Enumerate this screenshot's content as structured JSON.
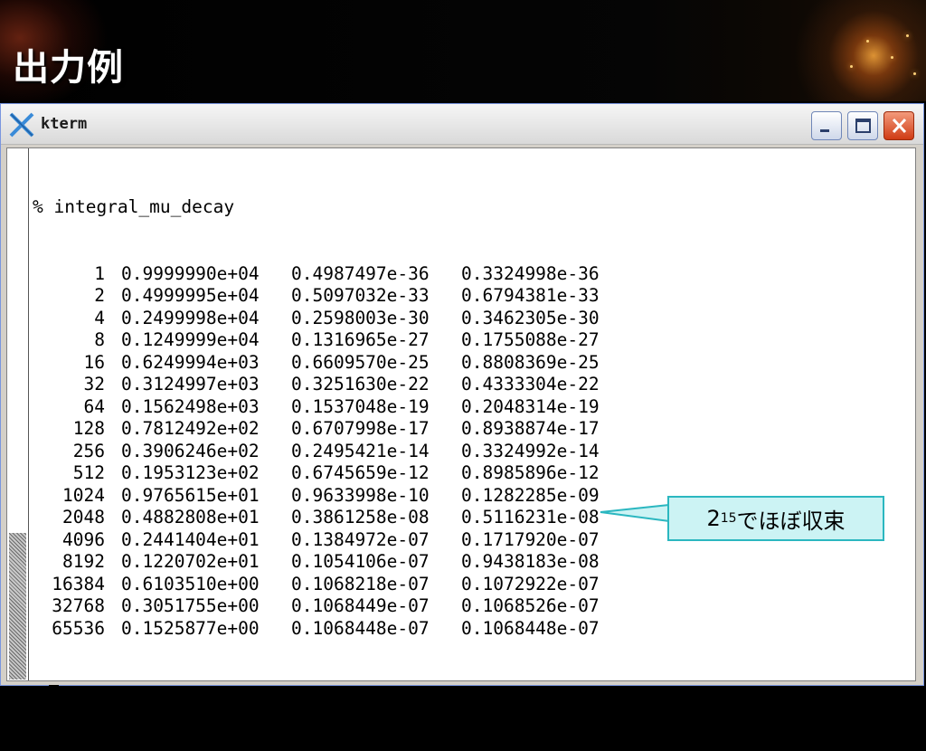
{
  "slide": {
    "title": "出力例"
  },
  "window": {
    "title": "kterm",
    "app_icon": "x-logo-icon",
    "controls": [
      "minimize-icon",
      "maximize-icon",
      "close-icon"
    ]
  },
  "terminal": {
    "command_line": "% integral_mu_decay",
    "rows": [
      [
        "1",
        "0.9999990e+04",
        "0.4987497e-36",
        "0.3324998e-36"
      ],
      [
        "2",
        "0.4999995e+04",
        "0.5097032e-33",
        "0.6794381e-33"
      ],
      [
        "4",
        "0.2499998e+04",
        "0.2598003e-30",
        "0.3462305e-30"
      ],
      [
        "8",
        "0.1249999e+04",
        "0.1316965e-27",
        "0.1755088e-27"
      ],
      [
        "16",
        "0.6249994e+03",
        "0.6609570e-25",
        "0.8808369e-25"
      ],
      [
        "32",
        "0.3124997e+03",
        "0.3251630e-22",
        "0.4333304e-22"
      ],
      [
        "64",
        "0.1562498e+03",
        "0.1537048e-19",
        "0.2048314e-19"
      ],
      [
        "128",
        "0.7812492e+02",
        "0.6707998e-17",
        "0.8938874e-17"
      ],
      [
        "256",
        "0.3906246e+02",
        "0.2495421e-14",
        "0.3324992e-14"
      ],
      [
        "512",
        "0.1953123e+02",
        "0.6745659e-12",
        "0.8985896e-12"
      ],
      [
        "1024",
        "0.9765615e+01",
        "0.9633998e-10",
        "0.1282285e-09"
      ],
      [
        "2048",
        "0.4882808e+01",
        "0.3861258e-08",
        "0.5116231e-08"
      ],
      [
        "4096",
        "0.2441404e+01",
        "0.1384972e-07",
        "0.1717920e-07"
      ],
      [
        "8192",
        "0.1220702e+01",
        "0.1054106e-07",
        "0.9438183e-08"
      ],
      [
        "16384",
        "0.6103510e+00",
        "0.1068218e-07",
        "0.1072922e-07"
      ],
      [
        "32768",
        "0.3051755e+00",
        "0.1068449e-07",
        "0.1068526e-07"
      ],
      [
        "65536",
        "0.1525877e+00",
        "0.1068448e-07",
        "0.1068448e-07"
      ]
    ],
    "prompt": "%"
  },
  "callout": {
    "base": "2",
    "exponent": "15",
    "text": "でほぼ収束"
  },
  "colors": {
    "callout_fill": "#ccf3f4",
    "callout_border": "#2bb7c0",
    "terminal_bg": "#ffffff",
    "slide_bg": "#000000"
  }
}
